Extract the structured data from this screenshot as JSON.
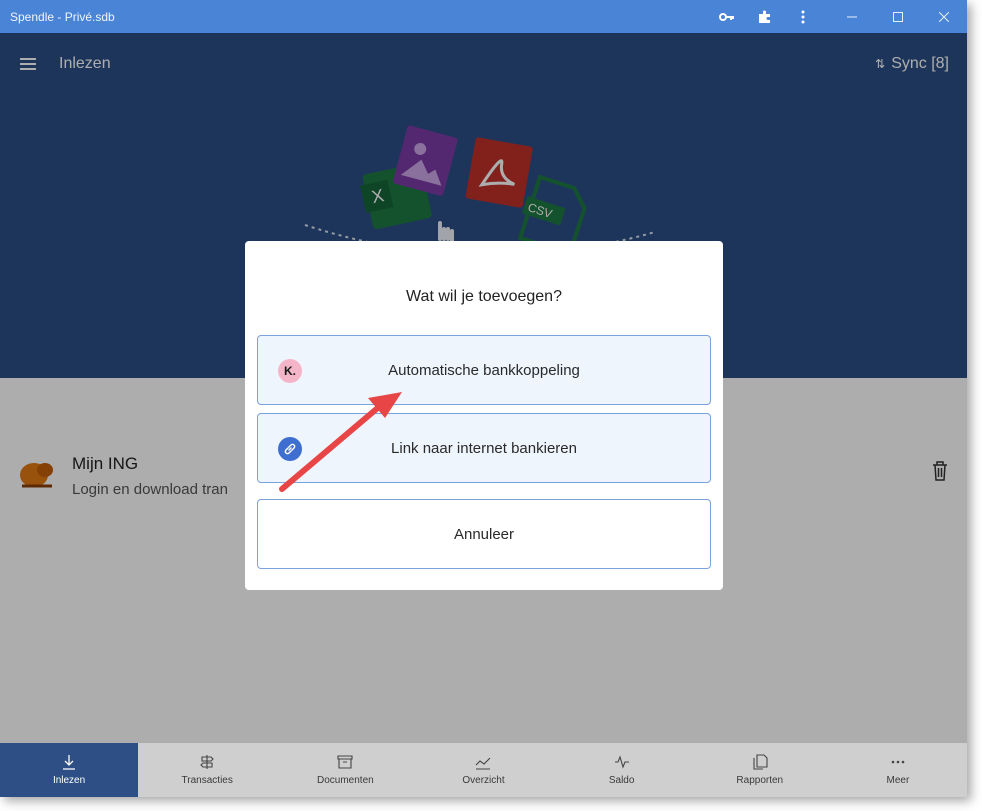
{
  "window": {
    "title": "Spendle - Privé.sdb",
    "titlebar_icons": [
      "key-icon",
      "puzzle-icon",
      "more-vert-icon"
    ],
    "controls": [
      "minimize-icon",
      "maximize-icon",
      "close-icon"
    ]
  },
  "appbar": {
    "title": "Inlezen",
    "sync_label": "Sync [8]",
    "menu_icon": "hamburger-menu-icon",
    "sync_icon": "sync-arrows-icon"
  },
  "hero": {
    "file_types": [
      "Excel",
      "Image",
      "PDF",
      "CSV"
    ]
  },
  "bank": {
    "name": "Mijn ING",
    "subtitle": "Login en download tran",
    "logo": "ing-lion-logo",
    "delete_icon": "trash-icon"
  },
  "dialog": {
    "title": "Wat wil je toevoegen?",
    "options": [
      {
        "label": "Automatische bankkoppeling",
        "icon": "klarna-k-icon",
        "badge_text": "K."
      },
      {
        "label": "Link naar internet bankieren",
        "icon": "link-icon"
      }
    ],
    "cancel_label": "Annuleer"
  },
  "nav": [
    {
      "label": "Inlezen",
      "icon": "download-icon",
      "active": true
    },
    {
      "label": "Transacties",
      "icon": "signpost-icon",
      "active": false
    },
    {
      "label": "Documenten",
      "icon": "archive-icon",
      "active": false
    },
    {
      "label": "Overzicht",
      "icon": "trend-line-icon",
      "active": false
    },
    {
      "label": "Saldo",
      "icon": "pulse-icon",
      "active": false
    },
    {
      "label": "Rapporten",
      "icon": "documents-icon",
      "active": false
    },
    {
      "label": "Meer",
      "icon": "more-horiz-icon",
      "active": false
    }
  ],
  "colors": {
    "titlebar": "#4a84d6",
    "primary": "#2d4f86",
    "option_border": "#7aa2dc",
    "arrow": "#e84646"
  }
}
